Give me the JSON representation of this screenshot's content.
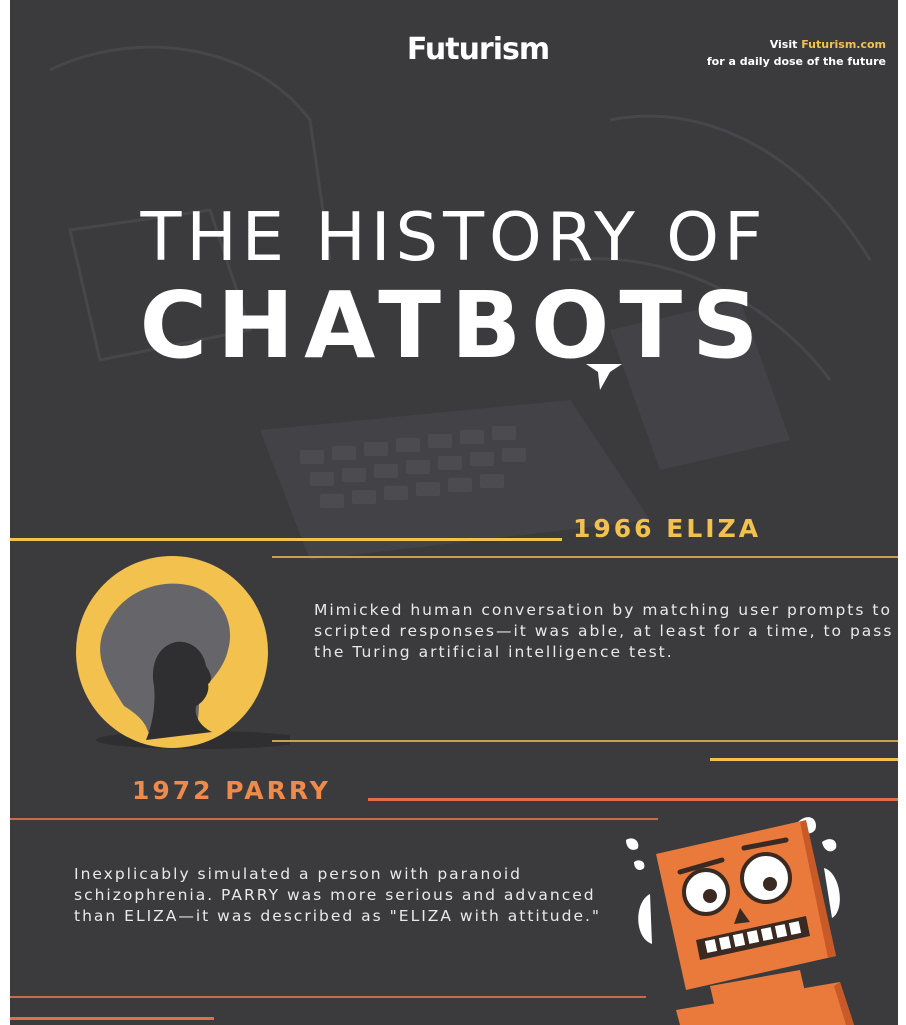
{
  "brand": {
    "name": "Futurism",
    "tagline_prefix": "Visit ",
    "tagline_site": "Futurism.com",
    "tagline_rest": "for a daily dose of the future"
  },
  "title": {
    "line1": "THE HISTORY OF",
    "line2": "CHATBOTS"
  },
  "entries": [
    {
      "heading": "1966 ELIZA",
      "description": "Mimicked human conversation by matching user prompts to scripted responses—it was able, at least for a time, to pass the Turing artificial intelligence test."
    },
    {
      "heading": "1972 PARRY",
      "description": "Inexplicably simulated a person with paranoid schizophrenia. PARRY was more serious and advanced than ELIZA—it was described as \"ELIZA with attitude.\""
    }
  ],
  "icons": [
    "woman-silhouette-icon",
    "nervous-robot-icon",
    "speech-bubble-icon"
  ],
  "colors": {
    "background": "#3b3b3e",
    "text": "#ffffff",
    "eliza_accent": "#f2c14e",
    "parry_accent": "#ef8a4a"
  }
}
